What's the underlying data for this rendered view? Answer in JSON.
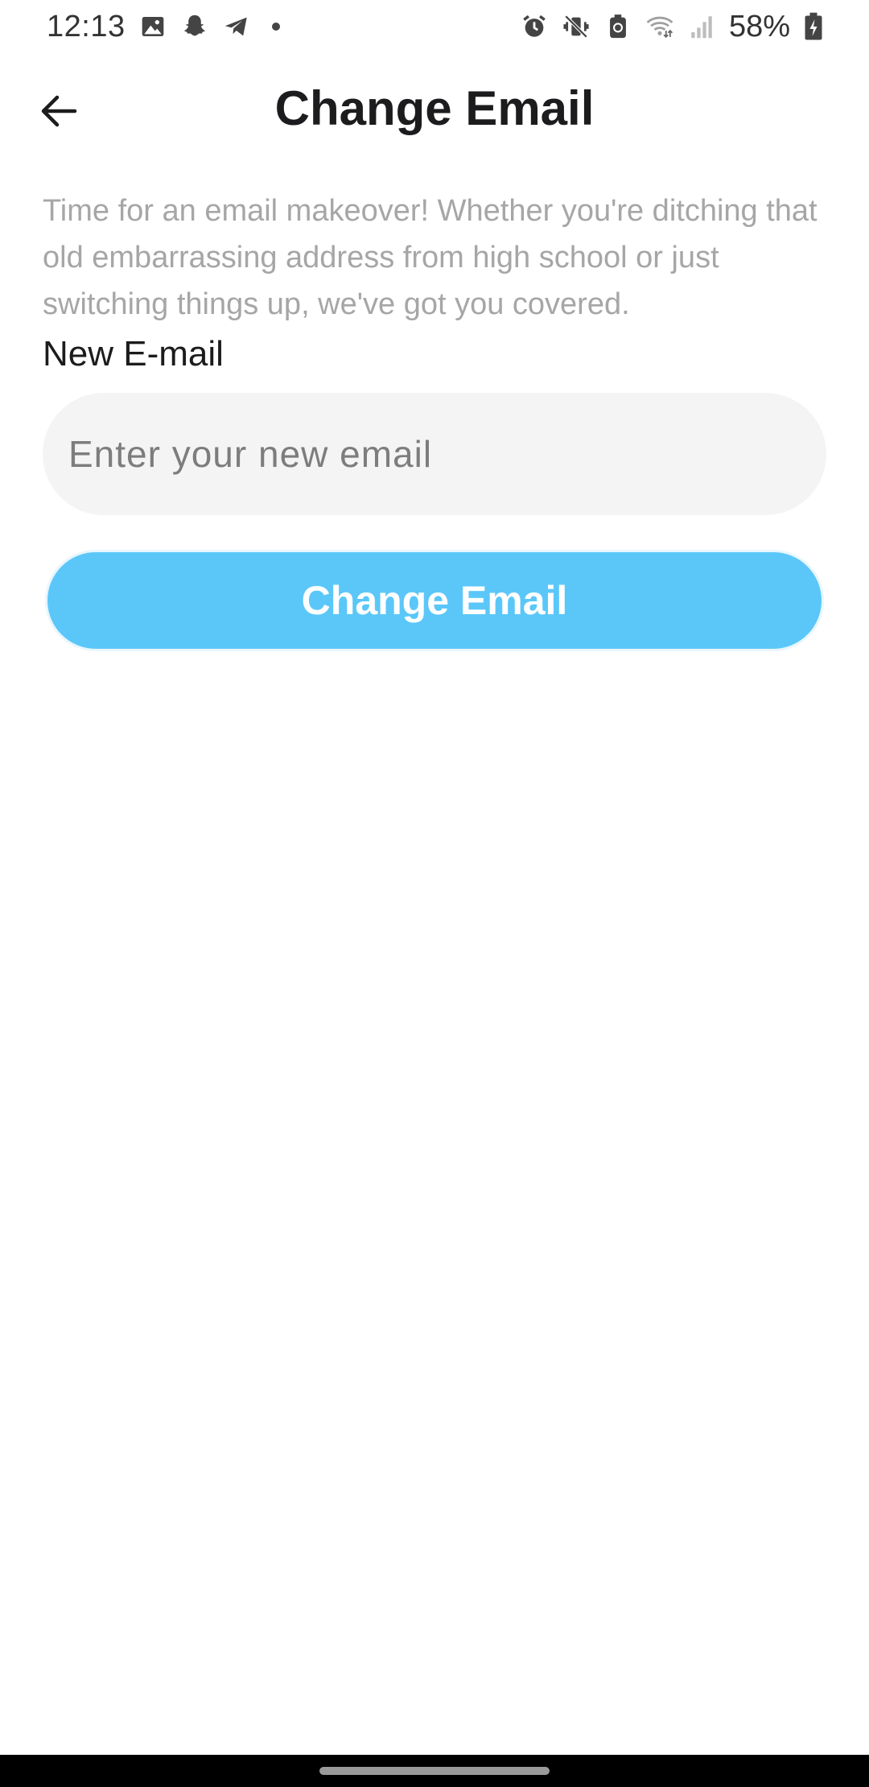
{
  "status_bar": {
    "time": "12:13",
    "battery_percent": "58%",
    "left_icons": [
      "gallery-icon",
      "snapchat-icon",
      "telegram-icon",
      "dot-icon"
    ],
    "right_icons": [
      "alarm-icon",
      "vibrate-mute-icon",
      "battery-saver-icon",
      "wifi-icon",
      "signal-icon",
      "battery-charging-icon"
    ]
  },
  "header": {
    "title": "Change Email",
    "back_icon": "arrow-left-icon"
  },
  "main": {
    "description": "Time for an email makeover! Whether you're ditching that old embarrassing address from high school or just switching things up, we've got you covered.",
    "field_label": "New E-mail",
    "email_input": {
      "value": "",
      "placeholder": "Enter your new email"
    },
    "submit_label": "Change Email"
  },
  "colors": {
    "accent": "#5bc7f9",
    "input_background": "#f4f4f4",
    "description_text": "#a6a6a6",
    "title_text": "#1c1c1e"
  }
}
